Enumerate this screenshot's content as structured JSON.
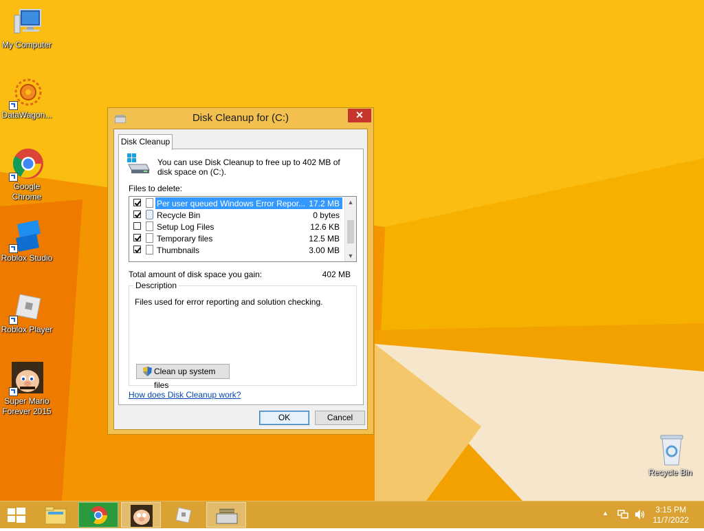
{
  "desktop": {
    "icons": [
      {
        "label": "My Computer"
      },
      {
        "label": "DataWagon..."
      },
      {
        "label": "Google Chrome"
      },
      {
        "label": "Roblox Studio"
      },
      {
        "label": "Roblox Player"
      },
      {
        "label": "Super Mario Forever 2015"
      },
      {
        "label": "Recycle Bin"
      }
    ]
  },
  "dialog": {
    "title": "Disk Cleanup for  (C:)",
    "close_label": "✕",
    "tab": "Disk Cleanup",
    "intro": "You can use Disk Cleanup to free up to 402 MB of disk space on  (C:).",
    "files_label": "Files to delete:",
    "files": [
      {
        "name": "Per user queued Windows Error Repor...",
        "size": "17.2 MB",
        "checked": true,
        "selected": true
      },
      {
        "name": "Recycle Bin",
        "size": "0 bytes",
        "checked": true,
        "selected": false
      },
      {
        "name": "Setup Log Files",
        "size": "12.6 KB",
        "checked": false,
        "selected": false
      },
      {
        "name": "Temporary files",
        "size": "12.5 MB",
        "checked": true,
        "selected": false
      },
      {
        "name": "Thumbnails",
        "size": "3.00 MB",
        "checked": true,
        "selected": false
      }
    ],
    "total_label": "Total amount of disk space you gain:",
    "total_value": "402 MB",
    "description_title": "Description",
    "description_text": "Files used for error reporting and solution checking.",
    "cleanup_button": "Clean up system files",
    "help_link": "How does Disk Cleanup work?",
    "ok": "OK",
    "cancel": "Cancel"
  },
  "taskbar": {
    "time": "3:15 PM",
    "date": "11/7/2022"
  },
  "colors": {
    "desktop_bg": "#f6b000",
    "accent_selected": "#3399ff",
    "close_red": "#c7362b"
  }
}
